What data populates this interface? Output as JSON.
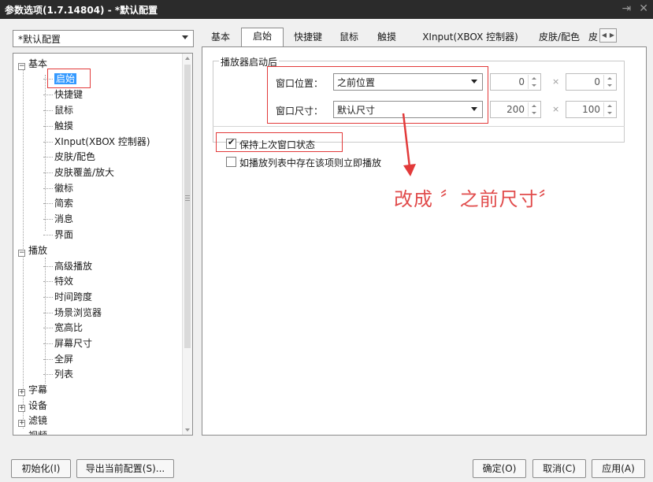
{
  "window": {
    "title": "参数选项(1.7.14804) - *默认配置"
  },
  "profile": {
    "selected": "*默认配置"
  },
  "tree": {
    "groups": [
      {
        "label": "基本",
        "expanded": true,
        "children": [
          "启始",
          "快捷键",
          "鼠标",
          "触摸",
          "XInput(XBOX 控制器)",
          "皮肤/配色",
          "皮肤覆盖/放大",
          "徽标",
          "简索",
          "消息",
          "界面"
        ]
      },
      {
        "label": "播放",
        "expanded": true,
        "children": [
          "高级播放",
          "特效",
          "时间跨度",
          "场景浏览器",
          "宽高比",
          "屏幕尺寸",
          "全屏",
          "列表"
        ]
      },
      {
        "label": "字幕",
        "expanded": false
      },
      {
        "label": "设备",
        "expanded": false
      },
      {
        "label": "滤镜",
        "expanded": false
      },
      {
        "label": "视频",
        "expanded": false
      }
    ],
    "selected": "启始"
  },
  "tabs": [
    "基本",
    "启始",
    "快捷键",
    "鼠标",
    "触摸",
    "XInput(XBOX 控制器)",
    "皮肤/配色",
    "皮"
  ],
  "active_tab": "启始",
  "startup": {
    "group_title": "播放器启动后",
    "position_label": "窗口位置：",
    "position_value": "之前位置",
    "position_x": "0",
    "position_y": "0",
    "size_label": "窗口尺寸：",
    "size_value": "默认尺寸",
    "size_w": "200",
    "size_h": "100",
    "times_sign": "×",
    "keep_state_label": "保持上次窗口状态",
    "keep_state_checked": true,
    "play_if_in_list_label": "如播放列表中存在该项则立即播放",
    "play_if_in_list_checked": false
  },
  "annotation": "改成 〞之前尺寸〞",
  "buttons": {
    "init": "初始化(I)",
    "export": "导出当前配置(S)...",
    "ok": "确定(O)",
    "cancel": "取消(C)",
    "apply": "应用(A)"
  },
  "colors": {
    "titlebar": "#2b2b2b",
    "selection": "#3399ff",
    "annotation": "#e14c4c"
  }
}
